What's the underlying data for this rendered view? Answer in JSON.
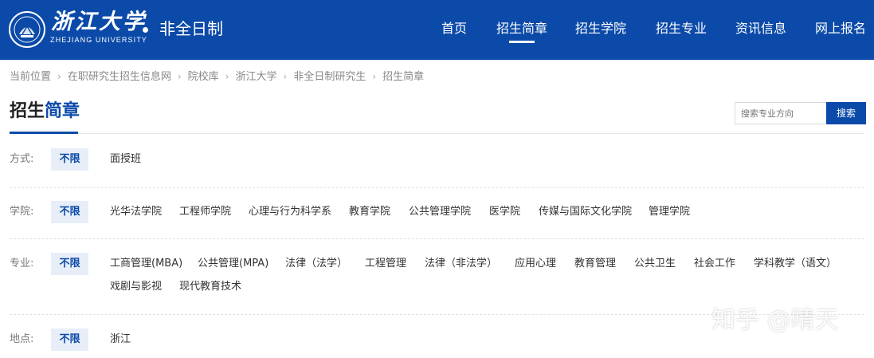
{
  "header": {
    "brand_cn": "浙江大学",
    "brand_en": "ZHEJIANG UNIVERSITY",
    "brand_sub": "非全日制",
    "nav": [
      "首页",
      "招生简章",
      "招生学院",
      "招生专业",
      "资讯信息",
      "网上报名"
    ],
    "nav_active": "招生简章"
  },
  "breadcrumb": [
    "当前位置",
    "在职研究生招生信息网",
    "院校库",
    "浙江大学",
    "非全日制研究生",
    "招生简章"
  ],
  "breadcrumb_sep": "›",
  "title": {
    "part1": "招生",
    "part2": "简章"
  },
  "search": {
    "placeholder": "搜索专业方向",
    "button": "搜索"
  },
  "filters": {
    "mode": {
      "label": "方式:",
      "badge": "不限",
      "options": [
        "面授班"
      ]
    },
    "college": {
      "label": "学院:",
      "badge": "不限",
      "options": [
        "光华法学院",
        "工程师学院",
        "心理与行为科学系",
        "教育学院",
        "公共管理学院",
        "医学院",
        "传媒与国际文化学院",
        "管理学院"
      ]
    },
    "major": {
      "label": "专业:",
      "badge": "不限",
      "options": [
        "工商管理(MBA)",
        "公共管理(MPA)",
        "法律（法学）",
        "工程管理",
        "法律（非法学）",
        "应用心理",
        "教育管理",
        "公共卫生",
        "社会工作",
        "学科教学（语文）",
        "戏剧与影视",
        "现代教育技术"
      ]
    },
    "location": {
      "label": "地点:",
      "badge": "不限",
      "options": [
        "浙江"
      ]
    }
  },
  "watermark": "知乎 @晴天",
  "colors": {
    "primary": "#0b4aa8",
    "badge_bg": "#e8eef8"
  }
}
